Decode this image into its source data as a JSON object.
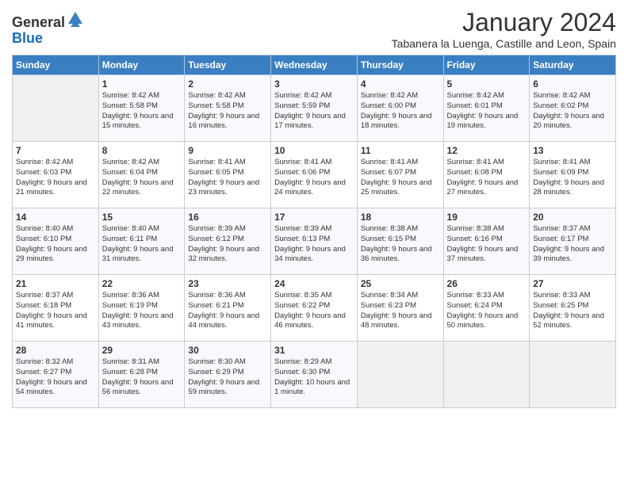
{
  "header": {
    "logo_general": "General",
    "logo_blue": "Blue",
    "month_title": "January 2024",
    "location": "Tabanera la Luenga, Castille and Leon, Spain"
  },
  "days_of_week": [
    "Sunday",
    "Monday",
    "Tuesday",
    "Wednesday",
    "Thursday",
    "Friday",
    "Saturday"
  ],
  "weeks": [
    [
      {
        "day": "",
        "empty": true
      },
      {
        "day": "1",
        "sunrise": "Sunrise: 8:42 AM",
        "sunset": "Sunset: 5:58 PM",
        "daylight": "Daylight: 9 hours and 15 minutes."
      },
      {
        "day": "2",
        "sunrise": "Sunrise: 8:42 AM",
        "sunset": "Sunset: 5:58 PM",
        "daylight": "Daylight: 9 hours and 16 minutes."
      },
      {
        "day": "3",
        "sunrise": "Sunrise: 8:42 AM",
        "sunset": "Sunset: 5:59 PM",
        "daylight": "Daylight: 9 hours and 17 minutes."
      },
      {
        "day": "4",
        "sunrise": "Sunrise: 8:42 AM",
        "sunset": "Sunset: 6:00 PM",
        "daylight": "Daylight: 9 hours and 18 minutes."
      },
      {
        "day": "5",
        "sunrise": "Sunrise: 8:42 AM",
        "sunset": "Sunset: 6:01 PM",
        "daylight": "Daylight: 9 hours and 19 minutes."
      },
      {
        "day": "6",
        "sunrise": "Sunrise: 8:42 AM",
        "sunset": "Sunset: 6:02 PM",
        "daylight": "Daylight: 9 hours and 20 minutes."
      }
    ],
    [
      {
        "day": "7",
        "sunrise": "Sunrise: 8:42 AM",
        "sunset": "Sunset: 6:03 PM",
        "daylight": "Daylight: 9 hours and 21 minutes."
      },
      {
        "day": "8",
        "sunrise": "Sunrise: 8:42 AM",
        "sunset": "Sunset: 6:04 PM",
        "daylight": "Daylight: 9 hours and 22 minutes."
      },
      {
        "day": "9",
        "sunrise": "Sunrise: 8:41 AM",
        "sunset": "Sunset: 6:05 PM",
        "daylight": "Daylight: 9 hours and 23 minutes."
      },
      {
        "day": "10",
        "sunrise": "Sunrise: 8:41 AM",
        "sunset": "Sunset: 6:06 PM",
        "daylight": "Daylight: 9 hours and 24 minutes."
      },
      {
        "day": "11",
        "sunrise": "Sunrise: 8:41 AM",
        "sunset": "Sunset: 6:07 PM",
        "daylight": "Daylight: 9 hours and 25 minutes."
      },
      {
        "day": "12",
        "sunrise": "Sunrise: 8:41 AM",
        "sunset": "Sunset: 6:08 PM",
        "daylight": "Daylight: 9 hours and 27 minutes."
      },
      {
        "day": "13",
        "sunrise": "Sunrise: 8:41 AM",
        "sunset": "Sunset: 6:09 PM",
        "daylight": "Daylight: 9 hours and 28 minutes."
      }
    ],
    [
      {
        "day": "14",
        "sunrise": "Sunrise: 8:40 AM",
        "sunset": "Sunset: 6:10 PM",
        "daylight": "Daylight: 9 hours and 29 minutes."
      },
      {
        "day": "15",
        "sunrise": "Sunrise: 8:40 AM",
        "sunset": "Sunset: 6:11 PM",
        "daylight": "Daylight: 9 hours and 31 minutes."
      },
      {
        "day": "16",
        "sunrise": "Sunrise: 8:39 AM",
        "sunset": "Sunset: 6:12 PM",
        "daylight": "Daylight: 9 hours and 32 minutes."
      },
      {
        "day": "17",
        "sunrise": "Sunrise: 8:39 AM",
        "sunset": "Sunset: 6:13 PM",
        "daylight": "Daylight: 9 hours and 34 minutes."
      },
      {
        "day": "18",
        "sunrise": "Sunrise: 8:38 AM",
        "sunset": "Sunset: 6:15 PM",
        "daylight": "Daylight: 9 hours and 36 minutes."
      },
      {
        "day": "19",
        "sunrise": "Sunrise: 8:38 AM",
        "sunset": "Sunset: 6:16 PM",
        "daylight": "Daylight: 9 hours and 37 minutes."
      },
      {
        "day": "20",
        "sunrise": "Sunrise: 8:37 AM",
        "sunset": "Sunset: 6:17 PM",
        "daylight": "Daylight: 9 hours and 39 minutes."
      }
    ],
    [
      {
        "day": "21",
        "sunrise": "Sunrise: 8:37 AM",
        "sunset": "Sunset: 6:18 PM",
        "daylight": "Daylight: 9 hours and 41 minutes."
      },
      {
        "day": "22",
        "sunrise": "Sunrise: 8:36 AM",
        "sunset": "Sunset: 6:19 PM",
        "daylight": "Daylight: 9 hours and 43 minutes."
      },
      {
        "day": "23",
        "sunrise": "Sunrise: 8:36 AM",
        "sunset": "Sunset: 6:21 PM",
        "daylight": "Daylight: 9 hours and 44 minutes."
      },
      {
        "day": "24",
        "sunrise": "Sunrise: 8:35 AM",
        "sunset": "Sunset: 6:22 PM",
        "daylight": "Daylight: 9 hours and 46 minutes."
      },
      {
        "day": "25",
        "sunrise": "Sunrise: 8:34 AM",
        "sunset": "Sunset: 6:23 PM",
        "daylight": "Daylight: 9 hours and 48 minutes."
      },
      {
        "day": "26",
        "sunrise": "Sunrise: 8:33 AM",
        "sunset": "Sunset: 6:24 PM",
        "daylight": "Daylight: 9 hours and 50 minutes."
      },
      {
        "day": "27",
        "sunrise": "Sunrise: 8:33 AM",
        "sunset": "Sunset: 6:25 PM",
        "daylight": "Daylight: 9 hours and 52 minutes."
      }
    ],
    [
      {
        "day": "28",
        "sunrise": "Sunrise: 8:32 AM",
        "sunset": "Sunset: 6:27 PM",
        "daylight": "Daylight: 9 hours and 54 minutes."
      },
      {
        "day": "29",
        "sunrise": "Sunrise: 8:31 AM",
        "sunset": "Sunset: 6:28 PM",
        "daylight": "Daylight: 9 hours and 56 minutes."
      },
      {
        "day": "30",
        "sunrise": "Sunrise: 8:30 AM",
        "sunset": "Sunset: 6:29 PM",
        "daylight": "Daylight: 9 hours and 59 minutes."
      },
      {
        "day": "31",
        "sunrise": "Sunrise: 8:29 AM",
        "sunset": "Sunset: 6:30 PM",
        "daylight": "Daylight: 10 hours and 1 minute."
      },
      {
        "day": "",
        "empty": true
      },
      {
        "day": "",
        "empty": true
      },
      {
        "day": "",
        "empty": true
      }
    ]
  ]
}
